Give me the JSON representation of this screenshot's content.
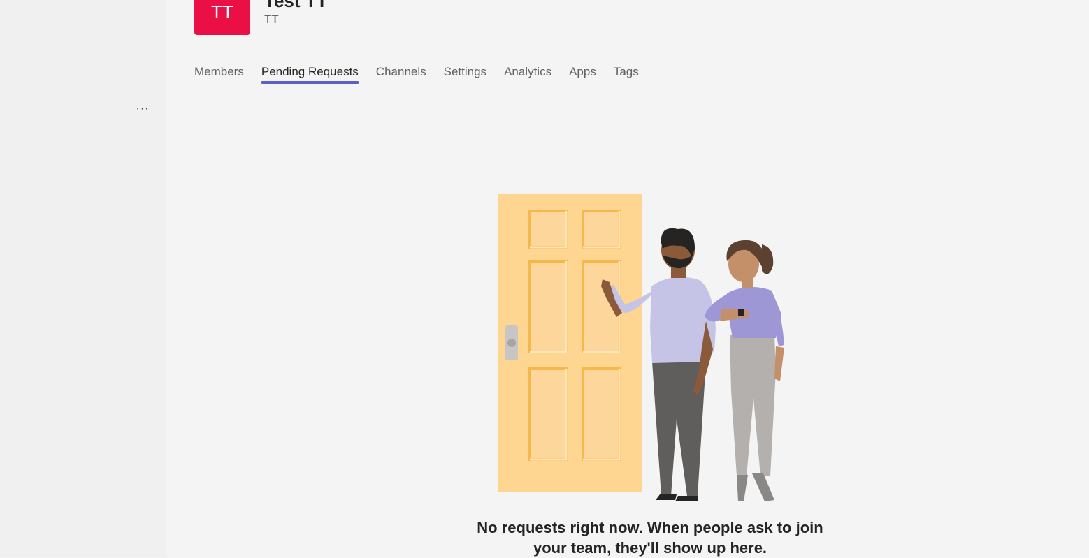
{
  "team": {
    "avatar_initials": "TT",
    "name": "Test TT",
    "subtitle": "TT"
  },
  "sidebar": {
    "more_label": "···"
  },
  "tabs": [
    {
      "label": "Members"
    },
    {
      "label": "Pending Requests"
    },
    {
      "label": "Channels"
    },
    {
      "label": "Settings"
    },
    {
      "label": "Analytics"
    },
    {
      "label": "Apps"
    },
    {
      "label": "Tags"
    }
  ],
  "active_tab": "Pending Requests",
  "empty_state": {
    "message": "No requests right now. When people ask to join your team, they'll show up here."
  },
  "colors": {
    "accent": "#5b5fc7",
    "avatar": "#ea1046",
    "door": "#ffd691"
  }
}
